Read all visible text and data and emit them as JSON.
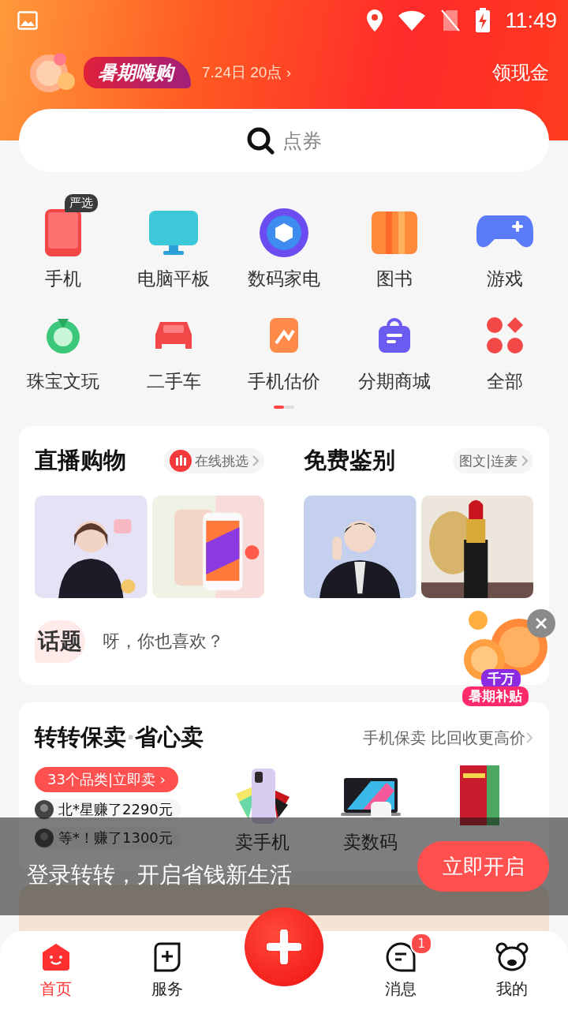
{
  "status_bar": {
    "time": "11:49"
  },
  "promo": {
    "badge": "暑期嗨购",
    "date": "7.24日 20点 ›",
    "link": "领现金"
  },
  "search": {
    "placeholder": "点券"
  },
  "categories": [
    {
      "label": "手机",
      "tag": "严选"
    },
    {
      "label": "电脑平板"
    },
    {
      "label": "数码家电"
    },
    {
      "label": "图书"
    },
    {
      "label": "游戏"
    },
    {
      "label": "珠宝文玩"
    },
    {
      "label": "二手车"
    },
    {
      "label": "手机估价"
    },
    {
      "label": "分期商城"
    },
    {
      "label": "全部"
    }
  ],
  "pager": [
    {
      "selected": true
    },
    {
      "selected": false
    }
  ],
  "feature": {
    "columns": [
      {
        "title": "直播购物",
        "pill": "在线挑选",
        "live": true
      },
      {
        "title": "免费鉴别",
        "pill": "图文|连麦",
        "live": false
      }
    ],
    "topic": {
      "badge": "话题",
      "text": "呀，你也喜欢？"
    }
  },
  "floating": {
    "line1": "千万",
    "line2": "暑期补贴"
  },
  "sell": {
    "title": "转转保卖",
    "separator": "·",
    "title2": "省心卖",
    "subtitle": "手机保卖 比回收更高价",
    "button": "33个品类|立即卖 ›",
    "earnings": [
      "北*星赚了2290元",
      "等*！赚了1300元"
    ],
    "products": [
      {
        "kind": "phone",
        "label": "卖手机"
      },
      {
        "kind": "laptop",
        "label": "卖数码"
      },
      {
        "kind": "book"
      }
    ]
  },
  "login_banner": {
    "text": "登录转转，开启省钱新生活",
    "button": "立即开启"
  },
  "nav": [
    {
      "label": "首页",
      "selected": true
    },
    {
      "label": "服务",
      "selected": false
    },
    {
      "label": "消息",
      "selected": false,
      "badge": "1"
    },
    {
      "label": "我的",
      "selected": false
    }
  ]
}
